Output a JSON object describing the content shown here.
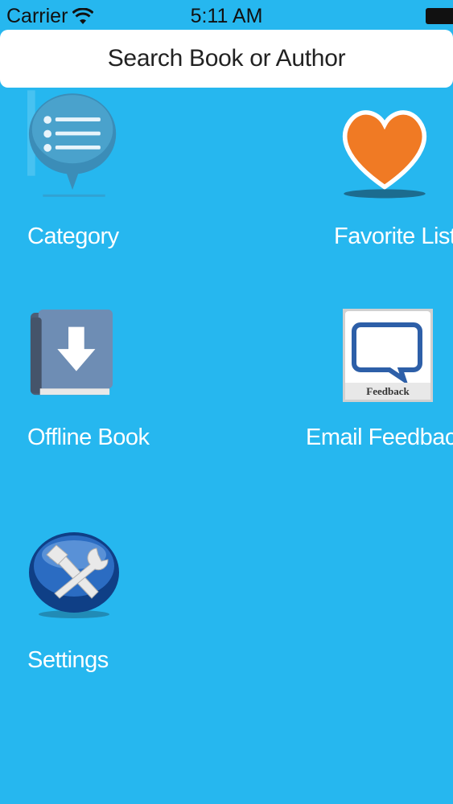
{
  "status_bar": {
    "carrier": "Carrier",
    "time": "5:11 AM"
  },
  "search": {
    "label": "Search Book or Author"
  },
  "menu": {
    "category": "Category",
    "favorite": "Favorite List",
    "offline": "Offline Book",
    "feedback": "Email Feedback",
    "feedback_icon_text": "Feedback",
    "settings": "Settings"
  },
  "colors": {
    "background": "#26b7ef",
    "heart": "#f07a24",
    "book": "#5f7ea5"
  }
}
